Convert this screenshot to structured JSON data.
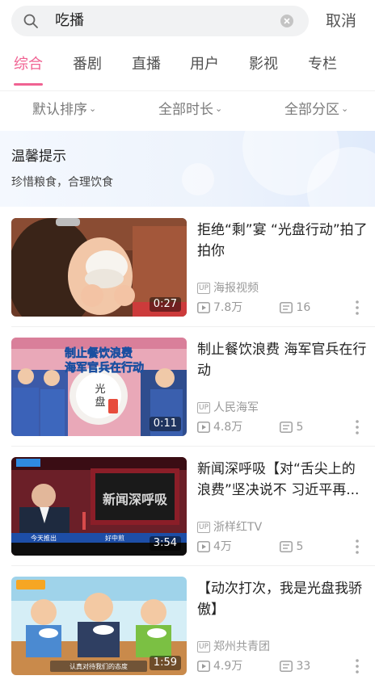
{
  "search": {
    "query": "吃播",
    "cancel_label": "取消"
  },
  "tabs": [
    {
      "label": "综合",
      "active": true
    },
    {
      "label": "番剧",
      "active": false
    },
    {
      "label": "直播",
      "active": false
    },
    {
      "label": "用户",
      "active": false
    },
    {
      "label": "影视",
      "active": false
    },
    {
      "label": "专栏",
      "active": false
    }
  ],
  "filters": {
    "sort": "默认排序",
    "duration": "全部时长",
    "zone": "全部分区"
  },
  "tip": {
    "title": "温馨提示",
    "text": "珍惜粮食，合理饮食"
  },
  "videos": [
    {
      "title": "拒绝“剩”宴 “光盘行动”拍了拍你",
      "uploader": "海报视频",
      "views": "7.8万",
      "comments": "16",
      "duration": "0:27",
      "up_badge": "UP"
    },
    {
      "title": "制止餐饮浪费 海军官兵在行动",
      "uploader": "人民海军",
      "views": "4.8万",
      "comments": "5",
      "duration": "0:11",
      "up_badge": "UP",
      "thumb_text_1": "制止餐饮浪费",
      "thumb_text_2": "海军官兵在行动",
      "thumb_text_3": "光",
      "thumb_text_4": "盘"
    },
    {
      "title": "新闻深呼吸【对“舌尖上的浪费”坚决说不 习近平再...",
      "uploader": "浙样红TV",
      "views": "4万",
      "comments": "5",
      "duration": "3:54",
      "up_badge": "UP",
      "thumb_text_1": "新闻深呼吸",
      "thumb_text_2": "今天推出",
      "thumb_text_3": "好中煎"
    },
    {
      "title": "【动次打次，我是光盘我骄傲】",
      "uploader": "郑州共青团",
      "views": "4.9万",
      "comments": "33",
      "duration": "1:59",
      "up_badge": "UP",
      "thumb_text_1": "认真对待我们的态度"
    }
  ],
  "colors": {
    "accent": "#f06292",
    "muted": "#999999"
  }
}
